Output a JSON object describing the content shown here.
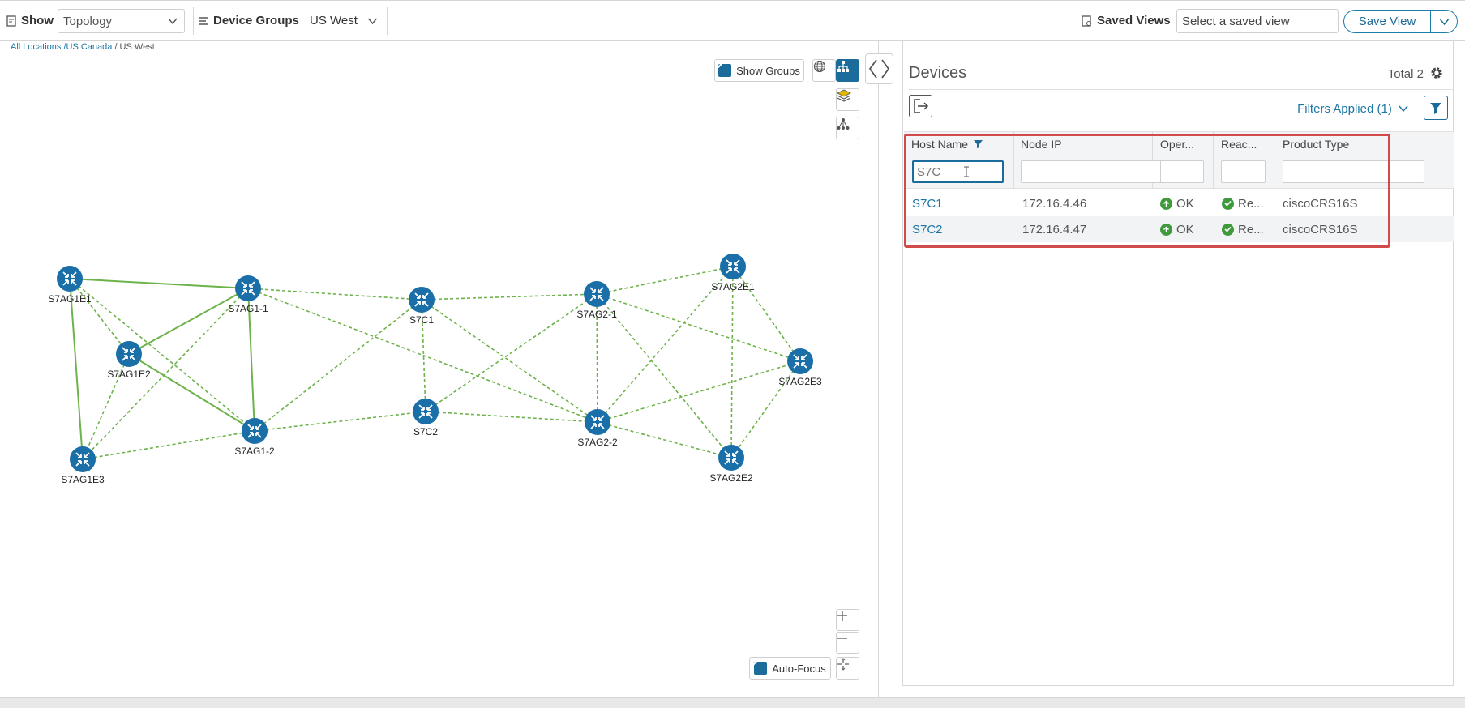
{
  "toolbar": {
    "show_label": "Show",
    "show_value": "Topology",
    "device_groups_label": "Device Groups",
    "device_groups_value": "US West",
    "saved_views_label": "Saved Views",
    "saved_view_placeholder": "Select a saved view",
    "save_view_label": "Save View"
  },
  "breadcrumb": {
    "items": [
      "All Locations",
      "/US Canada",
      "/ US West"
    ]
  },
  "map": {
    "show_groups_label": "Show Groups",
    "auto_focus_label": "Auto-Focus",
    "nodes": [
      {
        "id": "S7AG1E1",
        "label": "S7AG1E1"
      },
      {
        "id": "S7AG1-1",
        "label": "S7AG1-1"
      },
      {
        "id": "S7AG1E2",
        "label": "S7AG1E2"
      },
      {
        "id": "S7AG1E3",
        "label": "S7AG1E3"
      },
      {
        "id": "S7AG1-2",
        "label": "S7AG1-2"
      },
      {
        "id": "S7C1",
        "label": "S7C1"
      },
      {
        "id": "S7C2",
        "label": "S7C2"
      },
      {
        "id": "S7AG2-1",
        "label": "S7AG2-1"
      },
      {
        "id": "S7AG2-2",
        "label": "S7AG2-2"
      },
      {
        "id": "S7AG2E1",
        "label": "S7AG2E1"
      },
      {
        "id": "S7AG2E3",
        "label": "S7AG2E3"
      },
      {
        "id": "S7AG2E2",
        "label": "S7AG2E2"
      }
    ],
    "colors": {
      "node": "#1b6fa8",
      "link": "#6db24a"
    }
  },
  "devices": {
    "title": "Devices",
    "total_label": "Total 2",
    "filters_applied": "Filters Applied (1)",
    "columns": [
      "Host Name",
      "Node IP",
      "Oper...",
      "Reac...",
      "Product Type"
    ],
    "host_filter_value": "S7C",
    "rows": [
      {
        "host": "S7C1",
        "ip": "172.16.4.46",
        "oper": "OK",
        "reach": "Re...",
        "product": "ciscoCRS16S"
      },
      {
        "host": "S7C2",
        "ip": "172.16.4.47",
        "oper": "OK",
        "reach": "Re...",
        "product": "ciscoCRS16S"
      }
    ]
  }
}
